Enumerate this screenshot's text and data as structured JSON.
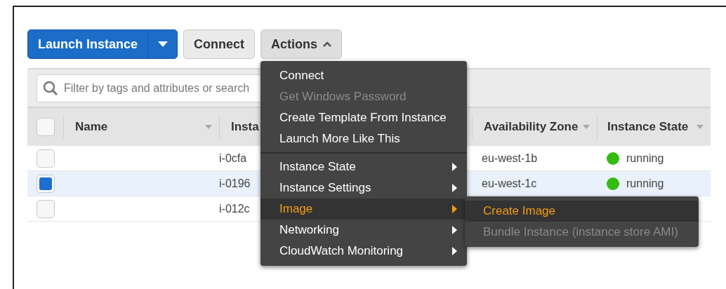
{
  "toolbar": {
    "launch_button": "Launch Instance",
    "connect_button": "Connect",
    "actions_button": {
      "label": "Actions",
      "expanded": true
    }
  },
  "filter": {
    "placeholder": "Filter by tags and attributes or search"
  },
  "table": {
    "columns": [
      "Name",
      "Insta",
      "Availability Zone",
      "Instance State"
    ],
    "header_checked": false,
    "rows": [
      {
        "selected": false,
        "name": "",
        "column_2": "i-0cfa",
        "zone": "eu-west-1b",
        "state": "running",
        "color": "#33bb11"
      },
      {
        "selected": true,
        "name": "",
        "column_2": "i-0196",
        "zone": "eu-west-1c",
        "state": "running",
        "color": "#33bb11"
      },
      {
        "selected": false,
        "name": "",
        "column_2": "i-012c",
        "zone": "",
        "state": ""
      }
    ]
  },
  "menu": {
    "groups": [
      [
        {
          "label": "Connect",
          "disabled": false,
          "submenu": false,
          "selected": false
        },
        {
          "label": "Get Windows Password",
          "disabled": true,
          "submenu": false,
          "selected": false
        },
        {
          "label": "Create Template From Instance",
          "disabled": false,
          "submenu": false,
          "selected": false
        },
        {
          "label": "Launch More Like This",
          "disabled": false,
          "submenu": false,
          "selected": false
        }
      ],
      [
        {
          "label": "Instance State",
          "disabled": false,
          "submenu": true,
          "selected": false
        },
        {
          "label": "Instance Settings",
          "disabled": false,
          "submenu": true,
          "selected": false
        },
        {
          "label": "Image",
          "disabled": false,
          "submenu": true,
          "selected": true
        },
        {
          "label": "Networking",
          "disabled": false,
          "submenu": true,
          "selected": false
        },
        {
          "label": "CloudWatch Monitoring",
          "disabled": false,
          "submenu": true,
          "selected": false
        }
      ]
    ]
  },
  "submenu": {
    "items": [
      {
        "label": "Create Image",
        "disabled": false,
        "selected": true
      },
      {
        "label": "Bundle Instance (instance store AMI)",
        "disabled": true,
        "selected": false
      }
    ]
  }
}
